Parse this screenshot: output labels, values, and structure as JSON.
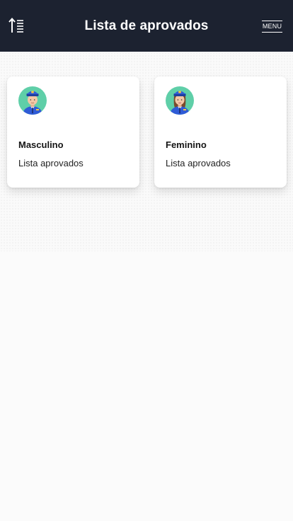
{
  "header": {
    "title": "Lista de aprovados",
    "menu_label": "MENU",
    "sort_icon": "sort-ascending-icon"
  },
  "cards": [
    {
      "title": "Masculino",
      "subtitle": "Lista aprovados",
      "icon": "male-police-officer-avatar-icon"
    },
    {
      "title": "Feminino",
      "subtitle": "Lista aprovados",
      "icon": "female-police-officer-avatar-icon"
    }
  ],
  "colors": {
    "header_bg": "#1c2230",
    "uniform": "#2f5bd6",
    "avatar_bg": "#5fcfa8",
    "skin": "#f3c7a6"
  }
}
